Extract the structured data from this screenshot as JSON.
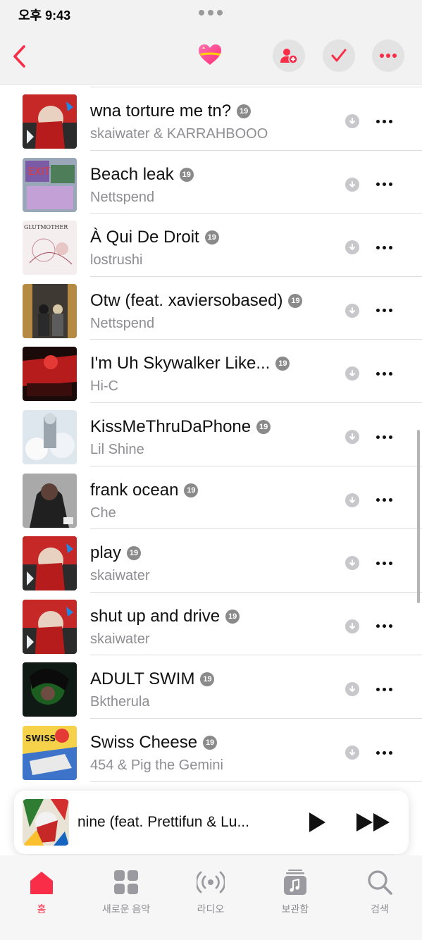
{
  "status": {
    "time": "오후 9:43"
  },
  "tracks": [
    {
      "title": "wna torture me tn?",
      "artist": "skaiwater & KARRAHBOOO",
      "badge": "19",
      "art": "red"
    },
    {
      "title": "Beach leak",
      "artist": "Nettspend",
      "badge": "19",
      "art": "collage"
    },
    {
      "title": "À Qui De Droit",
      "artist": "lostrushi",
      "badge": "19",
      "art": "sketch"
    },
    {
      "title": "Otw (feat. xaviersobased)",
      "artist": "Nettspend",
      "badge": "19",
      "art": "elevator"
    },
    {
      "title": "I'm Uh Skywalker Like...",
      "artist": "Hi-C",
      "badge": "19",
      "art": "darkred"
    },
    {
      "title": "KissMeThruDaPhone",
      "artist": "Lil Shine",
      "badge": "19",
      "art": "snow"
    },
    {
      "title": "frank ocean",
      "artist": "Che",
      "badge": "19",
      "art": "grey"
    },
    {
      "title": "play",
      "artist": "skaiwater",
      "badge": "19",
      "art": "red"
    },
    {
      "title": "shut up and drive",
      "artist": "skaiwater",
      "badge": "19",
      "art": "red"
    },
    {
      "title": "ADULT SWIM",
      "artist": "Bktherula",
      "badge": "19",
      "art": "green"
    },
    {
      "title": "Swiss Cheese",
      "artist": "454 & Pig the Gemini",
      "badge": "19",
      "art": "cartoon"
    }
  ],
  "now_playing": {
    "title": "nine (feat. Prettifun & Lu..."
  },
  "tabs": [
    {
      "label": "홈",
      "icon": "home-icon",
      "active": true
    },
    {
      "label": "새로운 음악",
      "icon": "grid-icon",
      "active": false
    },
    {
      "label": "라디오",
      "icon": "radio-icon",
      "active": false
    },
    {
      "label": "보관함",
      "icon": "library-icon",
      "active": false
    },
    {
      "label": "검색",
      "icon": "search-icon",
      "active": false
    }
  ],
  "colors": {
    "accent": "#fa2d48",
    "secondary_text": "#8e8e93"
  }
}
